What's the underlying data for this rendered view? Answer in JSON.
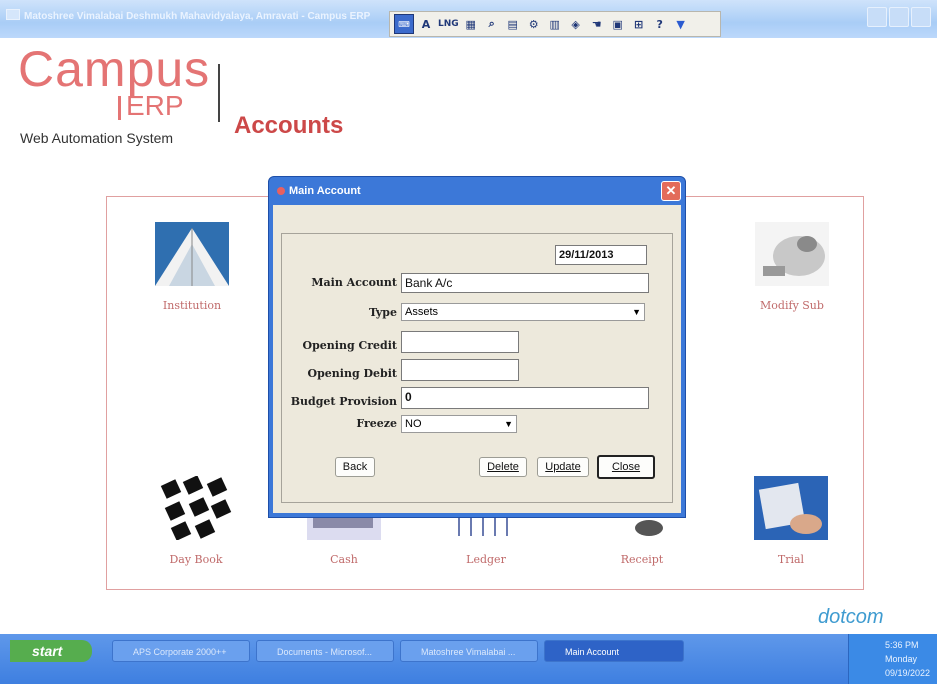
{
  "window": {
    "title": "Matoshree Vimalabai Deshmukh Mahavidyalaya, Amravati - Campus ERP"
  },
  "langbar": {
    "items": [
      "A",
      "LNG",
      "?"
    ]
  },
  "header": {
    "logo_main": "Campus",
    "logo_erp": "ERP",
    "logo_sub": "Web Automation System",
    "page_title": "Accounts"
  },
  "tiles": {
    "institution": "Institution",
    "modify_sub": "Modify Sub",
    "day_book": "Day Book",
    "cash": "Cash",
    "ledger": "Ledger",
    "receipt": "Receipt",
    "trial": "Trial"
  },
  "dialog": {
    "title": "Main Account",
    "date": "29/11/2013",
    "labels": {
      "main_account": "Main Account",
      "type": "Type",
      "opening_credit": "Opening Credit",
      "opening_debit": "Opening Debit",
      "budget_provision": "Budget Provision",
      "freeze": "Freeze"
    },
    "values": {
      "main_account": "Bank A/c",
      "type": "Assets",
      "opening_credit": "",
      "opening_debit": "",
      "budget_provision": "0",
      "freeze": "NO"
    },
    "buttons": {
      "back": "Back",
      "delete": "Delete",
      "update": "Update",
      "close": "Close"
    }
  },
  "brand": "dotcom",
  "taskbar": {
    "start": "start",
    "tasks": [
      "APS Corporate 2000++",
      "Documents - Microsof...",
      "Matoshree Vimalabai ...",
      "Main Account"
    ],
    "time": "5:36 PM",
    "day": "Monday",
    "date": "09/19/2022"
  },
  "colors": {
    "accent": "#e47474",
    "dialog_title": "#3c78d8",
    "taskbar": "#3e7fe0",
    "brand": "#3e9bd0"
  }
}
